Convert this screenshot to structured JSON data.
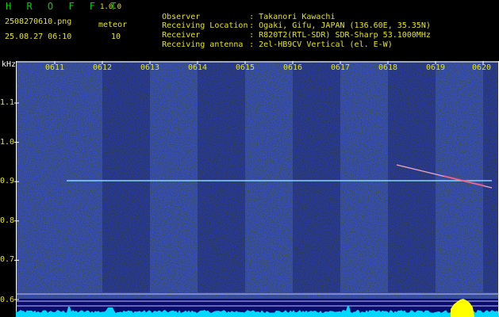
{
  "colors": {
    "title": "#00d000",
    "text": "#e8e800",
    "white": "#ffffff",
    "axis": "#ffffff",
    "cyan": "#00d8ff",
    "yellow": "#ffff00"
  },
  "header": {
    "title": "H R O F F T",
    "version": "1.0.0",
    "filename": "2508270610.png",
    "datetime": "25.08.27 06:10",
    "meteor_label": "meteor",
    "meteor_count": "10"
  },
  "info": [
    {
      "key": "Observer",
      "value": ": Takanori Kawachi"
    },
    {
      "key": "Receiving Location",
      "value": ": Ogaki, Gifu, JAPAN (136.60E, 35.35N)"
    },
    {
      "key": "Receiver",
      "value": ": R820T2(RTL-SDR) SDR-Sharp 53.1000MHz"
    },
    {
      "key": "Receiving antenna",
      "value": ": 2el-HB9CV Vertical (el. E-W)"
    }
  ],
  "plot": {
    "unit": "kHz",
    "y_ticks": [
      "1.1",
      "1.0",
      "0.9",
      "0.8",
      "0.7",
      "0.6"
    ],
    "x_ticks": [
      "0611",
      "0612",
      "0613",
      "0614",
      "0615",
      "0616",
      "0617",
      "0618",
      "0619",
      "0620"
    ]
  }
}
